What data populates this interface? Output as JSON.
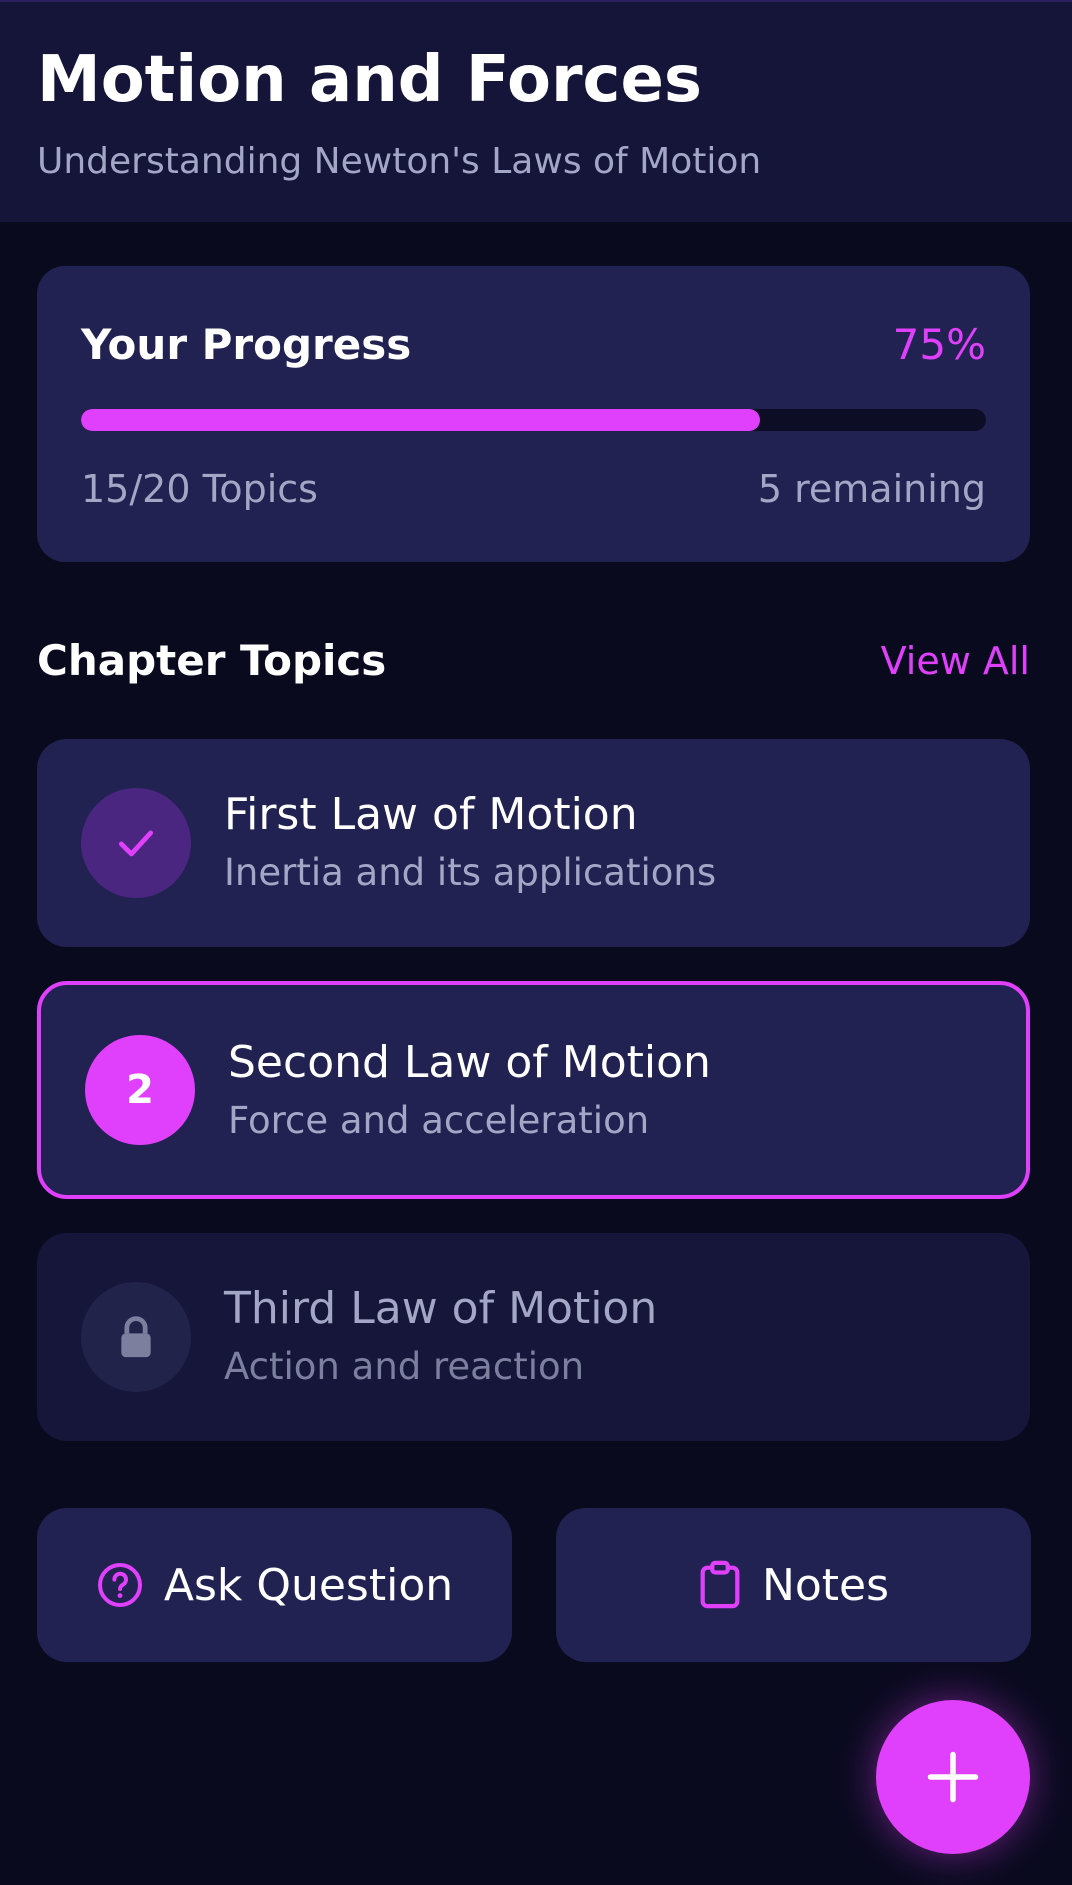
{
  "header": {
    "title": "Motion and Forces",
    "subtitle": "Understanding Newton's Laws of Motion"
  },
  "progress": {
    "title": "Your Progress",
    "percent_label": "75%",
    "percent_value": 0.75,
    "topics_label": "15/20 Topics",
    "remaining_label": "5 remaining"
  },
  "chapter": {
    "title": "Chapter Topics",
    "view_all": "View All"
  },
  "topics": [
    {
      "name": "First Law of Motion",
      "description": "Inertia and its applications",
      "status": "completed",
      "icon": "check-icon"
    },
    {
      "name": "Second Law of Motion",
      "description": "Force and acceleration",
      "status": "current",
      "badge": "2"
    },
    {
      "name": "Third Law of Motion",
      "description": "Action and reaction",
      "status": "locked",
      "icon": "lock-icon"
    }
  ],
  "actions": {
    "ask_question": "Ask Question",
    "notes": "Notes"
  },
  "fab": {
    "icon": "plus-icon"
  },
  "colors": {
    "accent": "#e040fb",
    "background": "#0a0a1f",
    "header_bg": "#15153a",
    "card_bg": "#222252",
    "muted_text": "#a3a6c4"
  }
}
